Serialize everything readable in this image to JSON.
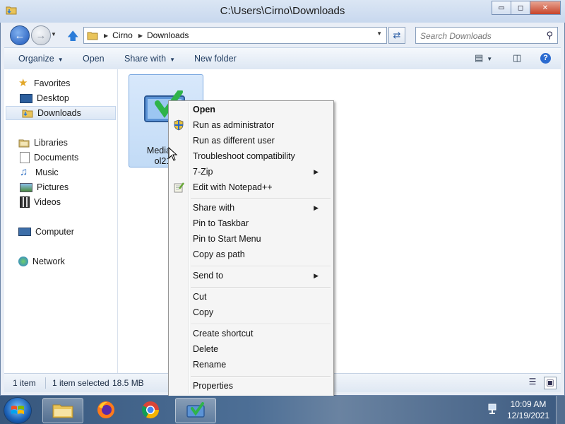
{
  "window": {
    "title": "C:\\Users\\Cirno\\Downloads",
    "controls": {
      "minimize": "▭",
      "maximize": "◻",
      "close": "✕"
    }
  },
  "address": {
    "crumbs": [
      "Cirno",
      "Downloads"
    ],
    "search_placeholder": "Search Downloads"
  },
  "commandbar": {
    "organize": "Organize",
    "open": "Open",
    "share_with": "Share with",
    "new_folder": "New folder"
  },
  "nav": {
    "favorites": "Favorites",
    "desktop": "Desktop",
    "downloads": "Downloads",
    "libraries": "Libraries",
    "documents": "Documents",
    "music": "Music",
    "pictures": "Pictures",
    "videos": "Videos",
    "computer": "Computer",
    "network": "Network"
  },
  "file": {
    "name_line1": "MediaCre",
    "name_line2": "ol21H"
  },
  "status": {
    "item_count": "1 item",
    "selected": "1 item selected",
    "size": "18.5 MB"
  },
  "context_menu": {
    "items": [
      "Open",
      "Run as administrator",
      "Run as different user",
      "Troubleshoot compatibility",
      "7-Zip",
      "Edit with Notepad++",
      "Share with",
      "Pin to Taskbar",
      "Pin to Start Menu",
      "Copy as path",
      "Send to",
      "Cut",
      "Copy",
      "Create shortcut",
      "Delete",
      "Rename",
      "Properties"
    ]
  },
  "taskbar": {
    "time": "10:09 AM",
    "date": "12/19/2021"
  },
  "colors": {
    "selection_blue": "#c2dbf6",
    "accent": "#2b6bd0"
  }
}
